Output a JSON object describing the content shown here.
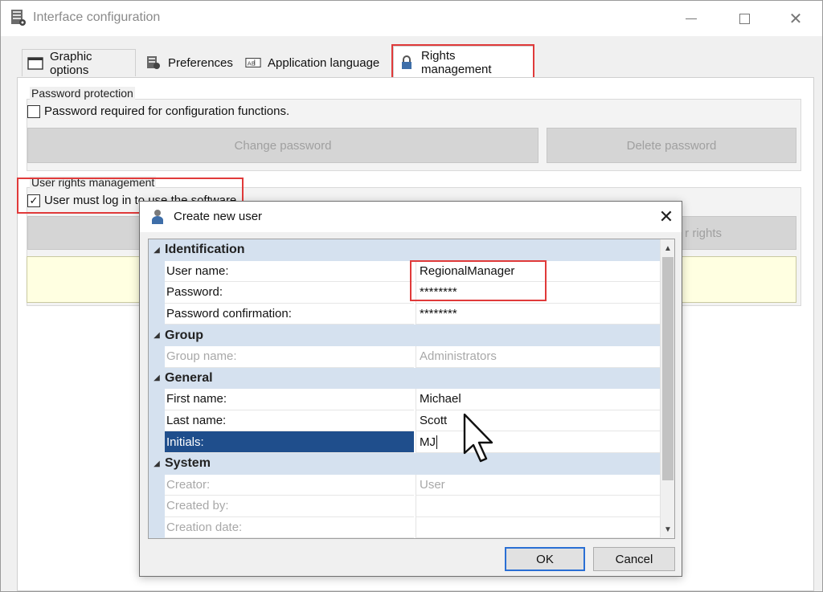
{
  "window": {
    "title": "Interface configuration",
    "controls": {
      "minimize": "",
      "maximize": "",
      "close": "✕"
    }
  },
  "tabs": [
    {
      "label": "Graphic options",
      "icon": "window-icon"
    },
    {
      "label": "Preferences",
      "icon": "settings-icon"
    },
    {
      "label": "Application language",
      "icon": "language-icon"
    },
    {
      "label": "Rights management",
      "icon": "lock-icon",
      "active": true
    }
  ],
  "password_protection": {
    "group_label": "Password protection",
    "checkbox_label": "Password required for configuration functions.",
    "checked": false,
    "change_password_label": "Change password",
    "delete_password_label": "Delete password"
  },
  "user_rights": {
    "group_label": "User rights management",
    "checkbox_label": "User must log in to use the software",
    "checked": true,
    "partial_button_label": "r rights"
  },
  "dialog": {
    "title": "Create new user",
    "close": "✕",
    "categories": [
      {
        "label": "Identification",
        "properties": [
          {
            "name": "User name:",
            "value": "RegionalManager"
          },
          {
            "name": "Password:",
            "value": "********"
          },
          {
            "name": "Password confirmation:",
            "value": "********"
          }
        ]
      },
      {
        "label": "Group",
        "properties": [
          {
            "name": "Group name:",
            "value": "Administrators",
            "disabled": true
          }
        ]
      },
      {
        "label": "General",
        "properties": [
          {
            "name": "First name:",
            "value": "Michael"
          },
          {
            "name": "Last name:",
            "value": "Scott"
          },
          {
            "name": "Initials:",
            "value": "MJ",
            "selected": true
          }
        ]
      },
      {
        "label": "System",
        "properties": [
          {
            "name": "Creator:",
            "value": "User",
            "disabled": true
          },
          {
            "name": "Created by:",
            "value": "",
            "disabled": true
          },
          {
            "name": "Creation date:",
            "value": "",
            "disabled": true
          }
        ]
      }
    ],
    "ok_label": "OK",
    "cancel_label": "Cancel"
  },
  "colors": {
    "highlight": "#e03a3a",
    "selection": "#1f4e8c",
    "category_band": "#d5e1ef",
    "info_background": "#ffffe1"
  }
}
